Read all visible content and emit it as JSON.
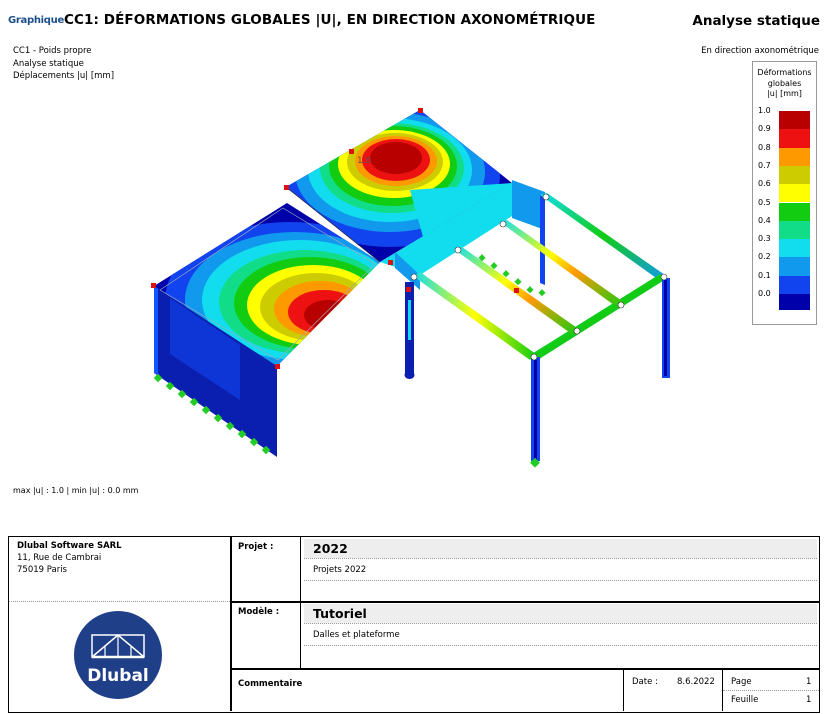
{
  "header": {
    "tag": "Graphique",
    "title": "CC1: DÉFORMATIONS GLOBALES |U|, EN DIRECTION AXONOMÉTRIQUE",
    "right": "Analyse statique"
  },
  "info": {
    "line1": "CC1 - Poids propre",
    "line2": "Analyse statique",
    "line3": "Déplacements |u| [mm]"
  },
  "direction_label": "En direction axonométrique",
  "legend": {
    "title_line1": "Déformations",
    "title_line2": "globales",
    "title_line3": "|u| [mm]",
    "entries": [
      {
        "label": "1.0",
        "color": "#b80000"
      },
      {
        "label": "0.9",
        "color": "#ee1111"
      },
      {
        "label": "0.8",
        "color": "#ff9900"
      },
      {
        "label": "0.7",
        "color": "#cccc00"
      },
      {
        "label": "0.6",
        "color": "#ffff00"
      },
      {
        "label": "0.5",
        "color": "#11cc11"
      },
      {
        "label": "0.4",
        "color": "#11dd88"
      },
      {
        "label": "0.3",
        "color": "#11ddee"
      },
      {
        "label": "0.2",
        "color": "#1199ee"
      },
      {
        "label": "0.1",
        "color": "#1144ee"
      },
      {
        "label": "0.0",
        "color": "#0000aa"
      }
    ]
  },
  "model": {
    "max_label": "1.0"
  },
  "minmax": "max |u| : 1.0 | min |u| : 0.0 mm",
  "title_block": {
    "company_name": "Dlubal Software SARL",
    "address1": "11, Rue de Cambrai",
    "address2": "75019 Paris",
    "logo_text": "Dlubal",
    "project_label": "Projet :",
    "project_value": "2022",
    "project_desc": "Projets 2022",
    "model_label": "Modèle :",
    "model_value": "Tutoriel",
    "model_desc": "Dalles et plateforme",
    "comment_label": "Commentaire",
    "date_label": "Date :",
    "date_value": "8.6.2022",
    "page_label": "Page",
    "page_value": "1",
    "sheet_label": "Feuille",
    "sheet_value": "1"
  }
}
